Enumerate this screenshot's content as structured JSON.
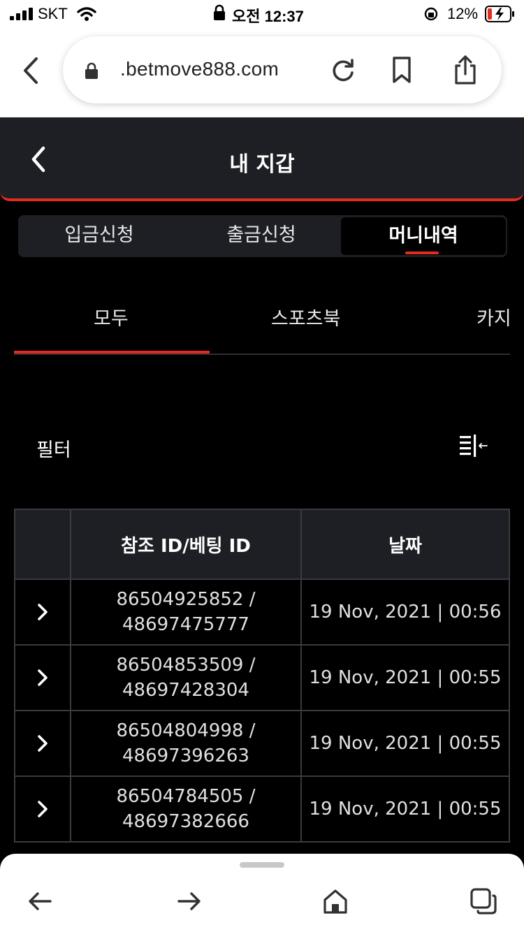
{
  "status_bar": {
    "carrier": "SKT",
    "time": "오전 12:37",
    "battery": "12%"
  },
  "browser": {
    "url": ".betmove888.com"
  },
  "header": {
    "title": "내 지갑"
  },
  "segment_tabs": [
    {
      "label": "입금신청",
      "active": false
    },
    {
      "label": "출금신청",
      "active": false
    },
    {
      "label": "머니내역",
      "active": true
    }
  ],
  "category_tabs": [
    {
      "label": "모두",
      "active": true
    },
    {
      "label": "스포츠북",
      "active": false
    },
    {
      "label": "카지",
      "active": false
    }
  ],
  "filter": {
    "label": "필터"
  },
  "table": {
    "headers": [
      "",
      "참조 ID/베팅 ID",
      "날짜"
    ],
    "rows": [
      {
        "ref_id": "86504925852 /",
        "bet_id": "48697475777",
        "date": "19 Nov, 2021 | 00:56"
      },
      {
        "ref_id": "86504853509 /",
        "bet_id": "48697428304",
        "date": "19 Nov, 2021 | 00:55"
      },
      {
        "ref_id": "86504804998 /",
        "bet_id": "48697396263",
        "date": "19 Nov, 2021 | 00:55"
      },
      {
        "ref_id": "86504784505 /",
        "bet_id": "48697382666",
        "date": "19 Nov, 2021 | 00:55"
      }
    ]
  },
  "colors": {
    "accent": "#e32b20",
    "panel": "#1e1f24",
    "background": "#000000"
  }
}
